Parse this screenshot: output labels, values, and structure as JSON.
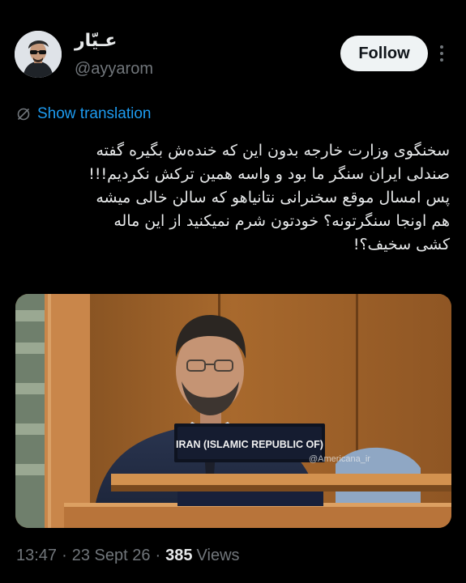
{
  "author": {
    "display_name": "عـيّار",
    "handle": "@ayyarom",
    "avatar_icon": "profile-photo"
  },
  "follow_label": "Follow",
  "more_icon": "more-vertical-icon",
  "translation": {
    "label": "Show translation",
    "icon": "globe-icon",
    "color": "#1d9bf0"
  },
  "tweet": {
    "lines": [
      "سخنگوی وزارت خارجه بدون این که خنده‌ش بگیره گفته",
      "صندلی ایران سنگر ما بود و واسه همین ترکش نکردیم!!!",
      "پس امسال موقع سخنرانی نتانیاهو که سالن خالی میشه",
      "هم اونجا سنگرتونه؟ خودتون شرم نمیکنید از این ماله",
      "کشی سخیف؟!"
    ]
  },
  "media": {
    "nameplate": "IRAN (ISLAMIC REPUBLIC OF)",
    "watermark": "@Americana_ir"
  },
  "meta": {
    "time": "13:47",
    "date": "23 Sept 26",
    "views_count": "385",
    "views_label": "Views"
  },
  "colors": {
    "background": "#000000",
    "text_primary": "#e7e9ea",
    "text_secondary": "#71767b",
    "link": "#1d9bf0",
    "follow_bg": "#eff3f4"
  }
}
